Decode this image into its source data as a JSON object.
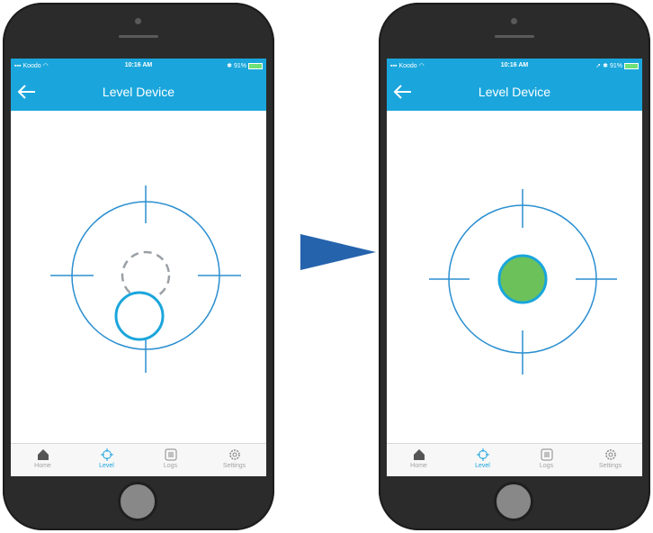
{
  "colors": {
    "accent": "#1aa6dc",
    "crosshair": "#2b8fd0",
    "bubble_fill_level": "#6cc15a",
    "bubble_ring": "#1aa6dc",
    "ghost_circle": "#9aa0a6",
    "arrow": "#2563ad",
    "phone_body": "#2b2b2b"
  },
  "screens": [
    {
      "state": "off-level",
      "status_bar": {
        "carrier": "Koodo",
        "time": "10:16 AM",
        "battery": "91%"
      },
      "nav": {
        "title": "Level Device",
        "back_icon": "back-arrow-icon"
      },
      "bubble_offset": {
        "x": -7,
        "y": 45
      },
      "ghost_circle_offset": {
        "x": 0,
        "y": 0
      },
      "tabs": [
        {
          "label": "Home",
          "icon": "home-icon",
          "active": false
        },
        {
          "label": "Level",
          "icon": "crosshair-icon",
          "active": true
        },
        {
          "label": "Logs",
          "icon": "list-icon",
          "active": false
        },
        {
          "label": "Settings",
          "icon": "gear-icon",
          "active": false
        }
      ]
    },
    {
      "state": "level",
      "status_bar": {
        "carrier": "Koodo",
        "time": "10:16 AM",
        "battery": "91%"
      },
      "nav": {
        "title": "Level Device",
        "back_icon": "back-arrow-icon"
      },
      "bubble_offset": {
        "x": 0,
        "y": 0
      },
      "tabs": [
        {
          "label": "Home",
          "icon": "home-icon",
          "active": false
        },
        {
          "label": "Level",
          "icon": "crosshair-icon",
          "active": true
        },
        {
          "label": "Logs",
          "icon": "list-icon",
          "active": false
        },
        {
          "label": "Settings",
          "icon": "gear-icon",
          "active": false
        }
      ]
    }
  ],
  "transition_icon": "right-arrow-icon"
}
